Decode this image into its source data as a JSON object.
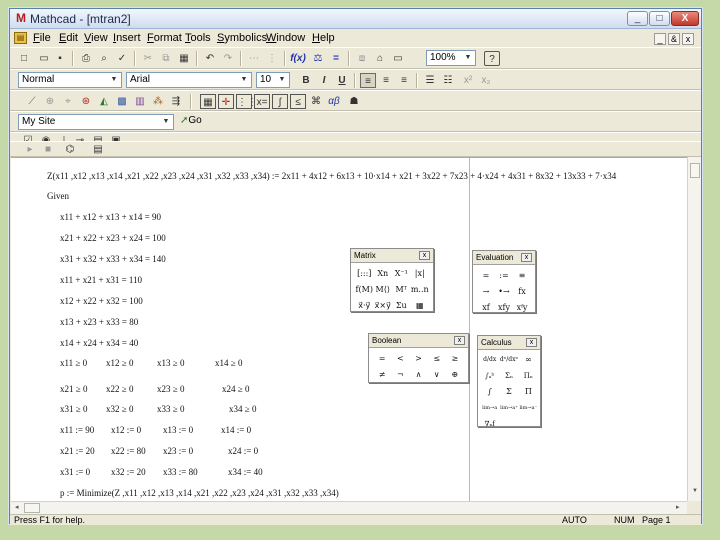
{
  "window": {
    "title": "Mathcad - [mtran2]",
    "logo": "M",
    "doc_icon": "doc-icon",
    "controls": [
      "_",
      "□",
      "X"
    ],
    "mdi_controls": [
      "_",
      "&",
      "x"
    ]
  },
  "menu": [
    "File",
    "Edit",
    "View",
    "Insert",
    "Format",
    "Tools",
    "Symbolics",
    "Window",
    "Help"
  ],
  "standard_toolbar": {
    "icons": [
      "new-icon",
      "open-icon",
      "save-icon",
      "print-icon",
      "print-preview-icon",
      "spell-check-icon",
      "cut-icon",
      "copy-icon",
      "paste-icon",
      "undo-icon",
      "redo-icon",
      "align-across-icon",
      "align-down-icon",
      "insert-function-icon",
      "insert-unit-icon",
      "calculate-icon",
      "component-icon",
      "resource-center-icon",
      "help-icon"
    ],
    "zoom": "100%"
  },
  "formatting_toolbar": {
    "style": "Normal",
    "font": "Arial",
    "size": "10",
    "bold": "B",
    "italic": "I",
    "underline": "U"
  },
  "math_toolbar": {
    "icons": [
      "calculator-palette-icon",
      "graph-palette-icon",
      "matrix-palette-icon",
      "evaluation-palette-icon",
      "calculus-palette-icon",
      "boolean-palette-icon",
      "programming-palette-icon",
      "greek-palette-icon",
      "symbolic-palette-icon"
    ],
    "greek_label": "αβ"
  },
  "web_toolbar": {
    "site": "My Site",
    "go": "Go"
  },
  "controls_toolbar": {
    "icons": [
      "checkbox-control-icon",
      "radio-control-icon",
      "slider-control-icon",
      "textbox-control-icon",
      "listbox-control-icon",
      "button-control-icon"
    ]
  },
  "debug_toolbar": {
    "icons": [
      "play-icon",
      "stop-icon",
      "trace-icon",
      "debug-window-icon"
    ]
  },
  "worksheet": {
    "objective": "Z(x11 ,x12 ,x13 ,x14 ,x21 ,x22 ,x23 ,x24 ,x31 ,x32 ,x33 ,x34) := 2x11 + 4x12 + 6x13 + 10·x14 + x21 + 3x22 + 7x23 + 4·x24 + 4x31 + 8x32 + 13x33 + 7·x34",
    "given": "Given",
    "constraints": [
      "x11 + x12 + x13 + x14 = 90",
      "x21 + x22 + x23 + x24 = 100",
      "x31 + x32 + x33 + x34 = 140",
      "x11 + x21 + x31 = 110",
      "x12 + x22 + x32 = 100",
      "x13 + x23 + x33 = 80",
      "x14 + x24 + x34 = 40"
    ],
    "nonneg_rows": [
      [
        "x11 ≥ 0",
        "x12 ≥ 0",
        "x13 ≥ 0",
        "x14 ≥ 0"
      ],
      [
        "x21 ≥ 0",
        "x22 ≥ 0",
        "x23 ≥ 0",
        "x24 ≥ 0"
      ],
      [
        "x31 ≥ 0",
        "x32 ≥ 0",
        "x33 ≥ 0",
        "x34 ≥ 0"
      ]
    ],
    "assign_rows": [
      [
        "x11 := 90",
        "x12 := 0",
        "x13 := 0",
        "x14 := 0"
      ],
      [
        "x21 := 20",
        "x22 := 80",
        "x23 := 0",
        "x24 := 0"
      ],
      [
        "x31 := 0",
        "x32 := 20",
        "x33 := 80",
        "x34 := 40"
      ]
    ],
    "minimize": "p := Minimize(Z ,x11 ,x12 ,x13 ,x14 ,x21 ,x22 ,x23 ,x24 ,x31 ,x32 ,x33 ,x34)"
  },
  "palettes": {
    "matrix": {
      "title": "Matrix",
      "cells": [
        "[:::]",
        "Xn",
        "X⁻¹",
        "|x|",
        "f(M)",
        "M⟨⟩",
        "Mᵀ",
        "m..n",
        "x⃗·y⃗",
        "x⃗×y⃗",
        "Σu",
        "▦"
      ]
    },
    "evaluation": {
      "title": "Evaluation",
      "cells": [
        "=",
        ":=",
        "≡",
        "→",
        "•→",
        "fx",
        "xf",
        "xfy",
        "xᶠy"
      ]
    },
    "boolean": {
      "title": "Boolean",
      "cells": [
        "=",
        "<",
        ">",
        "≤",
        "≥",
        "≠",
        "¬",
        "∧",
        "∨",
        "⊕"
      ]
    },
    "calculus": {
      "title": "Calculus",
      "cells": [
        "d/dx",
        "dⁿ/dxⁿ",
        "∞",
        "∫ₐᵇ",
        "Σₙ",
        "Πₙ",
        "∫",
        "Σ",
        "Π",
        "lim→a",
        "lim→a⁺",
        "lim→a⁻",
        "∇ₓf"
      ]
    }
  },
  "status": {
    "help": "Press F1 for help.",
    "calc_mode": "AUTO",
    "numlock": "NUM",
    "page": "Page 1"
  }
}
